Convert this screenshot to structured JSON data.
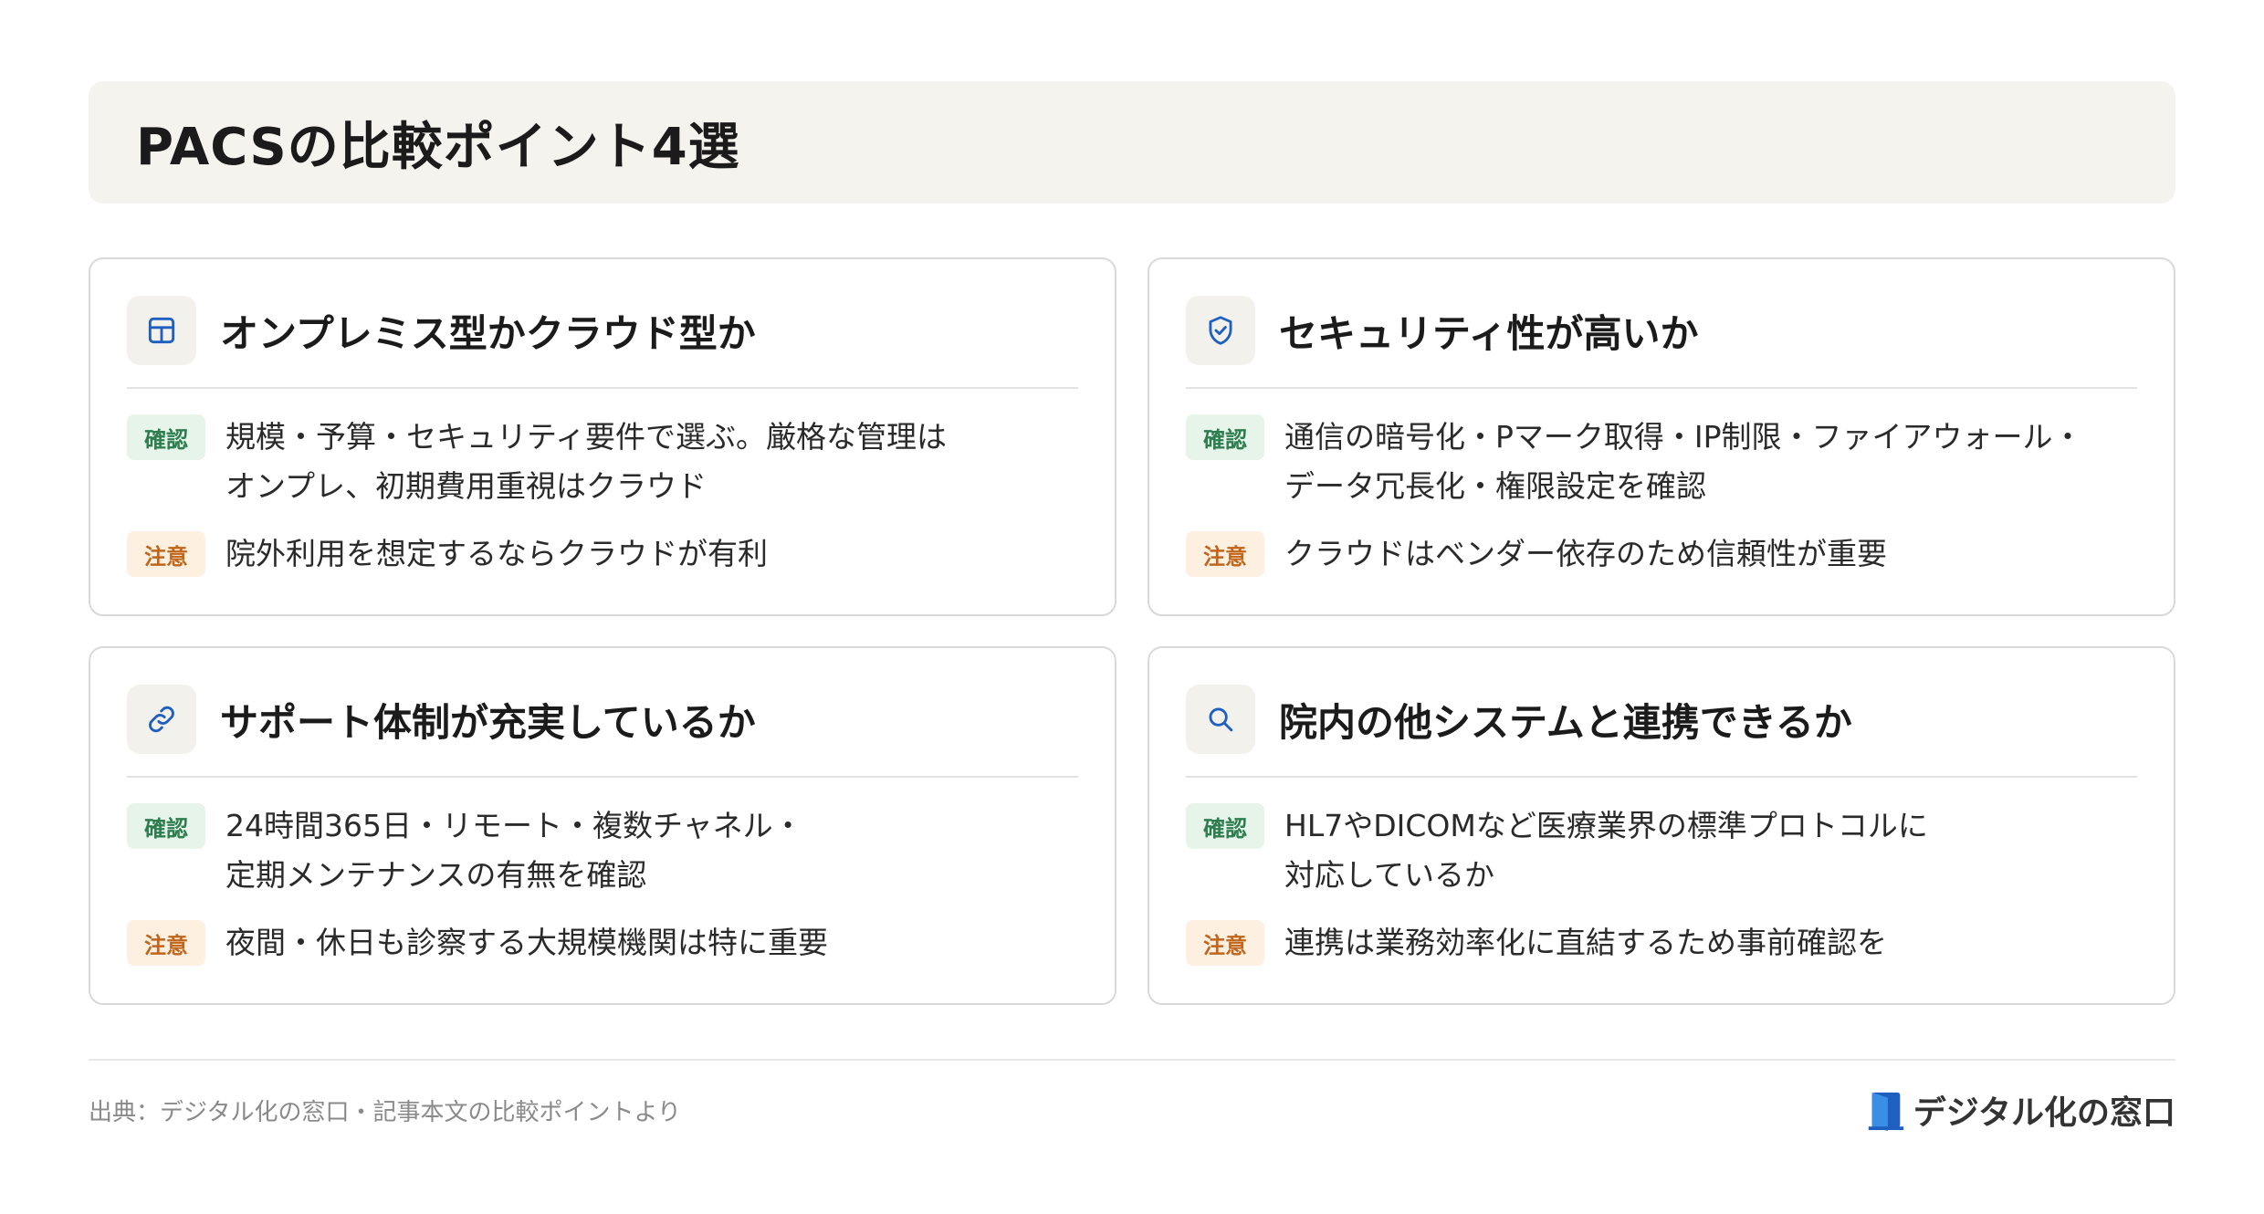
{
  "header": {
    "title": "PACSの比較ポイント4選"
  },
  "labels": {
    "check": "確認",
    "note": "注意"
  },
  "cards": [
    {
      "icon": "table-icon",
      "title": "オンプレミス型かクラウド型か",
      "check_line1": "規模・予算・セキュリティ要件で選ぶ。厳格な管理は",
      "check_line2": "オンプレ、初期費用重視はクラウド",
      "note": "院外利用を想定するならクラウドが有利"
    },
    {
      "icon": "shield-check-icon",
      "title": "セキュリティ性が高いか",
      "check_line1": "通信の暗号化・Pマーク取得・IP制限・ファイアウォール・",
      "check_line2": "データ冗長化・権限設定を確認",
      "note": "クラウドはベンダー依存のため信頼性が重要"
    },
    {
      "icon": "link-icon",
      "title": "サポート体制が充実しているか",
      "check_line1": "24時間365日・リモート・複数チャネル・",
      "check_line2": "定期メンテナンスの有無を確認",
      "note": "夜間・休日も診察する大規模機関は特に重要"
    },
    {
      "icon": "search-icon",
      "title": "院内の他システムと連携できるか",
      "check_line1": "HL7やDICOMなど医療業界の標準プロトコルに",
      "check_line2": "対応しているか",
      "note": "連携は業務効率化に直結するため事前確認を"
    }
  ],
  "footer": {
    "source": "出典：デジタル化の窓口・記事本文の比較ポイントより",
    "brand": "デジタル化の窓口"
  },
  "colors": {
    "accent_blue": "#1f5fbf",
    "check_badge_bg": "#e6f4ea",
    "check_badge_text": "#2e7d4f",
    "note_badge_bg": "#fdf0e1",
    "note_badge_text": "#c0651a",
    "header_bg": "#f5f3ee"
  }
}
